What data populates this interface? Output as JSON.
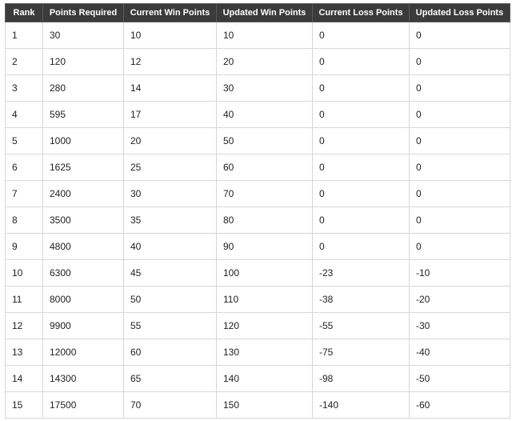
{
  "table": {
    "headers": [
      "Rank",
      "Points Required",
      "Current Win Points",
      "Updated Win Points",
      "Current Loss Points",
      "Updated Loss Points"
    ],
    "rows": [
      [
        "1",
        "30",
        "10",
        "10",
        "0",
        "0"
      ],
      [
        "2",
        "120",
        "12",
        "20",
        "0",
        "0"
      ],
      [
        "3",
        "280",
        "14",
        "30",
        "0",
        "0"
      ],
      [
        "4",
        "595",
        "17",
        "40",
        "0",
        "0"
      ],
      [
        "5",
        "1000",
        "20",
        "50",
        "0",
        "0"
      ],
      [
        "6",
        "1625",
        "25",
        "60",
        "0",
        "0"
      ],
      [
        "7",
        "2400",
        "30",
        "70",
        "0",
        "0"
      ],
      [
        "8",
        "3500",
        "35",
        "80",
        "0",
        "0"
      ],
      [
        "9",
        "4800",
        "40",
        "90",
        "0",
        "0"
      ],
      [
        "10",
        "6300",
        "45",
        "100",
        "-23",
        "-10"
      ],
      [
        "11",
        "8000",
        "50",
        "110",
        "-38",
        "-20"
      ],
      [
        "12",
        "9900",
        "55",
        "120",
        "-55",
        "-30"
      ],
      [
        "13",
        "12000",
        "60",
        "130",
        "-75",
        "-40"
      ],
      [
        "14",
        "14300",
        "65",
        "140",
        "-98",
        "-50"
      ],
      [
        "15",
        "17500",
        "70",
        "150",
        "-140",
        "-60"
      ]
    ]
  },
  "colors": {
    "header_background": "#3b3b3b",
    "header_text": "#ffffff",
    "cell_border": "#d8d8d8",
    "cell_text": "#222222"
  }
}
